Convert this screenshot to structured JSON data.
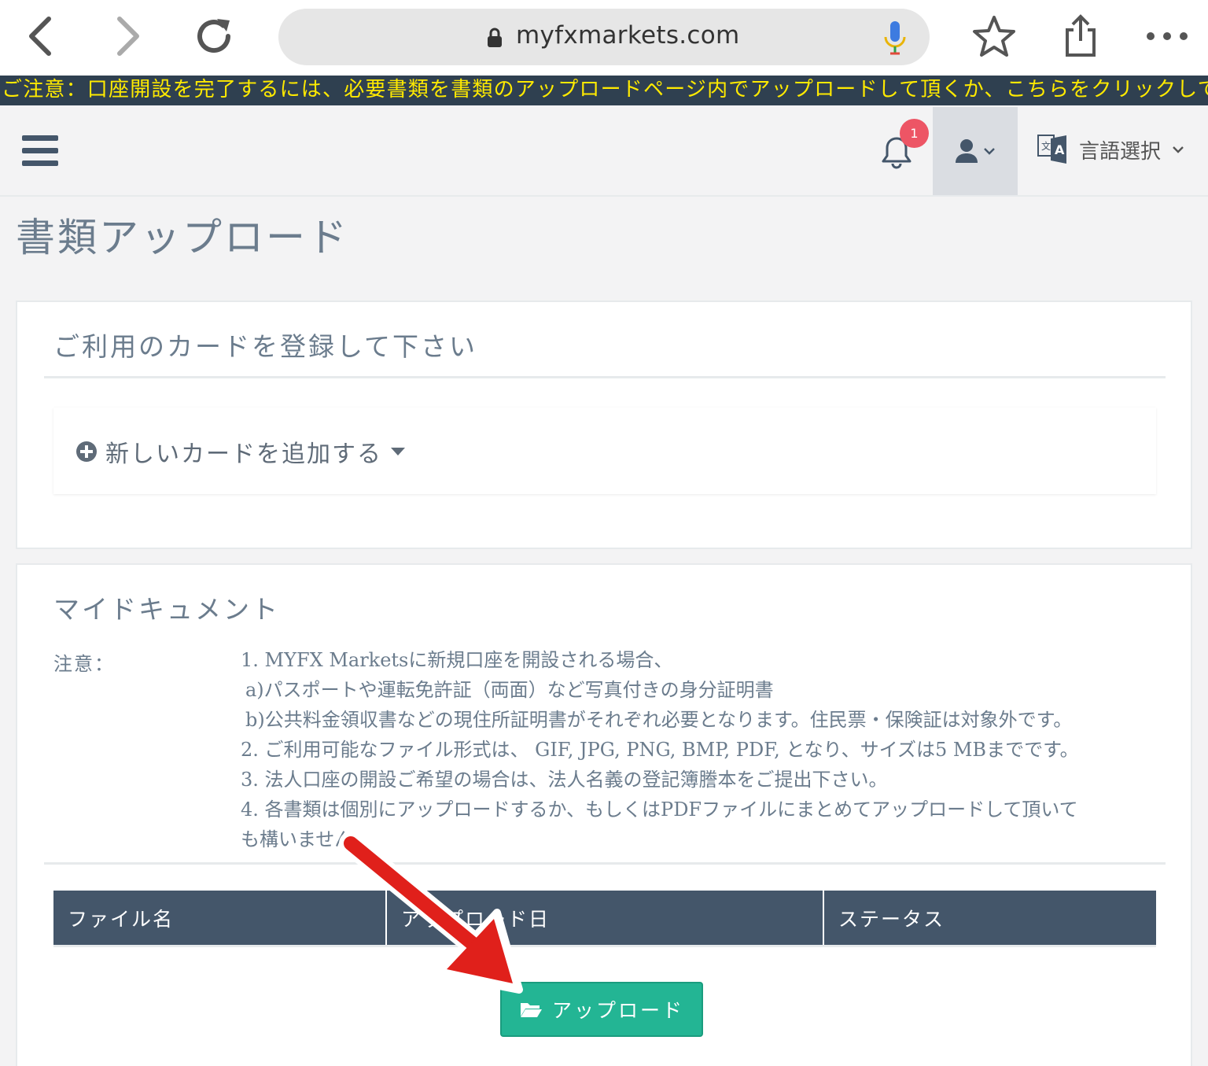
{
  "browser": {
    "url": "myfxmarkets.com"
  },
  "notice": {
    "text": "ご注意：口座開設を完了するには、必要書類を書類のアップロードページ内でアップロードして頂くか、こちらをクリックしてお手"
  },
  "navbar": {
    "notification_count": "1",
    "language_label": "言語選択"
  },
  "page": {
    "title": "書類アップロード"
  },
  "card_panel": {
    "title": "ご利用のカードを登録して下さい",
    "add_card_label": "新しいカードを追加する"
  },
  "documents_panel": {
    "title": "マイドキュメント",
    "notes_label": "注意：",
    "notes": [
      "1. MYFX Marketsに新規口座を開設される場合、",
      " a)パスポートや運転免許証（両面）など写真付きの身分証明書",
      " b)公共料金領収書などの現住所証明書がそれぞれ必要となります。住民票・保険証は対象外です。",
      "2. ご利用可能なファイル形式は、 GIF, JPG, PNG, BMP, PDF, となり、サイズは5 MBまでです。",
      "3. 法人口座の開設ご希望の場合は、法人名義の登記簿謄本をご提出下さい。",
      "4. 各書類は個別にアップロードするか、もしくはPDFファイルにまとめてアップロードして頂いて",
      "も構いません。"
    ],
    "table_headers": [
      "ファイル名",
      "アップロード日",
      "ステータス"
    ],
    "upload_label": "アップロード"
  },
  "colors": {
    "banner_bg": "#2f4050",
    "banner_text": "#ffea00",
    "table_header_bg": "#44566a",
    "upload_button": "#23b594",
    "badge": "#ed5565",
    "annotation_arrow": "#e0201b"
  }
}
